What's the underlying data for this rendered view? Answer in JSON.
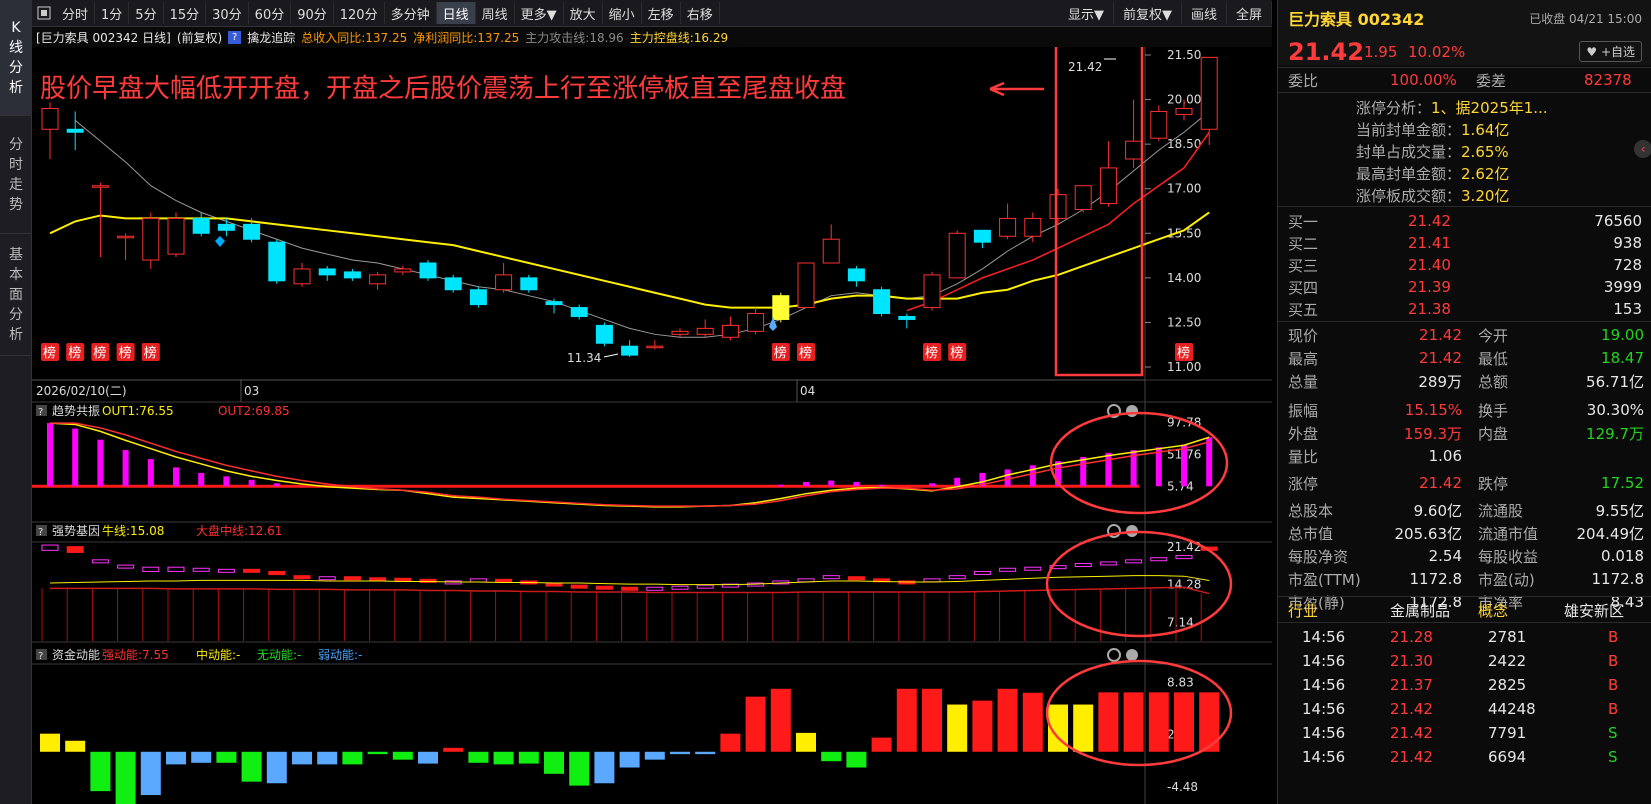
{
  "left_nav": {
    "tabs": [
      {
        "label": [
          "K",
          "线",
          "分",
          "析"
        ],
        "active": true
      },
      {
        "label": [
          "分",
          "时",
          "走",
          "势"
        ],
        "active": false
      },
      {
        "label": [
          "基",
          "本",
          "面",
          "分",
          "析"
        ],
        "active": false
      }
    ]
  },
  "toolbar": {
    "periods": [
      "分时",
      "1分",
      "5分",
      "15分",
      "30分",
      "60分",
      "90分",
      "120分",
      "多分钟",
      "日线",
      "周线",
      "更多▼"
    ],
    "active_period": "日线",
    "actions": [
      "放大",
      "缩小",
      "左移",
      "右移"
    ],
    "right_actions": [
      "显示▼",
      "前复权▼",
      "画线",
      "全屏"
    ]
  },
  "infobar": {
    "stock": "[巨力索具 002342 日线]",
    "adjust": "(前复权)",
    "q_icon": "?",
    "indicator": "擒龙追踪",
    "f1": "总收入同比:137.25",
    "f2": "净利润同比:137.25",
    "f3": "主力攻击线:18.96",
    "f4": "主力控盘线:16.29"
  },
  "main_chart": {
    "annotation": "股价早盘大幅低开开盘，开盘之后股价震荡上行至涨停板直至尾盘收盘",
    "y_ticks": [
      "21.50",
      "20.00",
      "18.50",
      "17.00",
      "15.50",
      "14.00",
      "12.50",
      "11.00"
    ],
    "high_label": "21.42",
    "low_label": "11.34",
    "date_labels": [
      "2026/02/10(二)",
      "03",
      "04"
    ],
    "bang_label": "榜",
    "colors": {
      "up": "#ff3030",
      "down": "#00e5ff",
      "ma_fast": "#ff2020",
      "ma_slow": "#ffee00",
      "ma_grey": "#9a9a9a",
      "annot": "#ff3b3b"
    }
  },
  "panel_trend": {
    "q": "?",
    "title": "趋势共振",
    "out1": "OUT1:76.55",
    "out2": "OUT2:69.85",
    "y_ticks": [
      "97.78",
      "51.76",
      "5.74"
    ]
  },
  "panel_strong": {
    "q": "?",
    "title": "强势基因",
    "l1": "牛线:15.08",
    "l2": "大盘中线:12.61",
    "y_ticks": [
      "21.42",
      "14.28",
      "7.14"
    ]
  },
  "panel_fund": {
    "q": "?",
    "title": "资金动能",
    "l1": "强动能:7.55",
    "l2": "中动能:-",
    "l3": "无动能:-",
    "l4": "弱动能:-",
    "y_ticks": [
      "8.83",
      "2.17",
      "-4.48"
    ]
  },
  "quote": {
    "name": "巨力索具 002342",
    "status": "已收盘 04/21 15:00",
    "price": "21.42",
    "change": "1.95",
    "pct": "10.02%",
    "watch": "+自选",
    "wb_label": "委比",
    "wb_value": "100.00%",
    "wc_label": "委差",
    "wc_value": "82378",
    "limit_lines": [
      "涨停分析：1、据2025年1...",
      "当前封单金额：1.64亿",
      "封单占成交量：2.65%",
      "最高封单金额：2.62亿",
      "涨停板成交额：3.20亿"
    ],
    "bids": [
      {
        "label": "买一",
        "price": "21.42",
        "vol": "76560"
      },
      {
        "label": "买二",
        "price": "21.41",
        "vol": "938"
      },
      {
        "label": "买三",
        "price": "21.40",
        "vol": "728"
      },
      {
        "label": "买四",
        "price": "21.39",
        "vol": "3999"
      },
      {
        "label": "买五",
        "price": "21.38",
        "vol": "153"
      }
    ],
    "stats": [
      {
        "l1": "现价",
        "v1": "21.42",
        "c1": "red",
        "l2": "今开",
        "v2": "19.00",
        "c2": "green"
      },
      {
        "l1": "最高",
        "v1": "21.42",
        "c1": "red",
        "l2": "最低",
        "v2": "18.47",
        "c2": "green"
      },
      {
        "l1": "总量",
        "v1": "289万",
        "c1": "white",
        "l2": "总额",
        "v2": "56.71亿",
        "c2": "white"
      },
      {
        "l1": "振幅",
        "v1": "15.15%",
        "c1": "red",
        "l2": "换手",
        "v2": "30.30%",
        "c2": "white"
      },
      {
        "l1": "外盘",
        "v1": "159.3万",
        "c1": "red",
        "l2": "内盘",
        "v2": "129.7万",
        "c2": "green"
      },
      {
        "l1": "量比",
        "v1": "1.06",
        "c1": "white",
        "l2": "",
        "v2": "",
        "c2": "white"
      },
      {
        "l1": "涨停",
        "v1": "21.42",
        "c1": "red",
        "l2": "跌停",
        "v2": "17.52",
        "c2": "green"
      },
      {
        "l1": "总股本",
        "v1": "9.60亿",
        "c1": "white",
        "l2": "流通股",
        "v2": "9.55亿",
        "c2": "white"
      },
      {
        "l1": "总市值",
        "v1": "205.63亿",
        "c1": "white",
        "l2": "流通市值",
        "v2": "204.49亿",
        "c2": "white"
      },
      {
        "l1": "每股净资",
        "v1": "2.54",
        "c1": "white",
        "l2": "每股收益",
        "v2": "0.018",
        "c2": "white"
      },
      {
        "l1": "市盈(TTM)",
        "v1": "1172.8",
        "c1": "white",
        "l2": "市盈(动)",
        "v2": "1172.8",
        "c2": "white"
      },
      {
        "l1": "市盈(静)",
        "v1": "1172.8",
        "c1": "white",
        "l2": "市净率",
        "v2": "8.43",
        "c2": "white"
      }
    ],
    "industry_label": "行业",
    "industry": "金属制品",
    "concept_label": "概念",
    "concept": "雄安新区",
    "ticks": [
      {
        "t": "14:56",
        "p": "21.28",
        "v": "2781",
        "s": "B"
      },
      {
        "t": "14:56",
        "p": "21.30",
        "v": "2422",
        "s": "B"
      },
      {
        "t": "14:56",
        "p": "21.37",
        "v": "2825",
        "s": "B"
      },
      {
        "t": "14:56",
        "p": "21.42",
        "v": "44248",
        "s": "B"
      },
      {
        "t": "14:56",
        "p": "21.42",
        "v": "7791",
        "s": "S"
      },
      {
        "t": "14:56",
        "p": "21.42",
        "v": "6694",
        "s": "S"
      }
    ]
  },
  "chart_data": {
    "type": "candlestick",
    "y_range": [
      11.0,
      21.5
    ],
    "candles": [
      [
        19.0,
        19.7,
        19.9,
        18.0
      ],
      [
        19.0,
        18.9,
        19.6,
        18.3
      ],
      [
        17.1,
        17.1,
        17.2,
        14.7
      ],
      [
        15.4,
        15.4,
        15.5,
        14.6
      ],
      [
        14.6,
        16.0,
        16.2,
        14.3
      ],
      [
        14.8,
        16.0,
        16.2,
        14.7
      ],
      [
        16.0,
        15.5,
        16.2,
        15.4
      ],
      [
        15.8,
        15.6,
        16.0,
        15.4
      ],
      [
        15.8,
        15.3,
        16.0,
        15.2
      ],
      [
        15.2,
        13.9,
        15.3,
        13.8
      ],
      [
        13.8,
        14.3,
        14.5,
        13.7
      ],
      [
        14.3,
        14.1,
        14.4,
        13.9
      ],
      [
        14.2,
        14.0,
        14.3,
        13.9
      ],
      [
        13.8,
        14.1,
        14.2,
        13.6
      ],
      [
        14.2,
        14.3,
        14.4,
        14.1
      ],
      [
        14.5,
        14.0,
        14.6,
        13.9
      ],
      [
        14.0,
        13.6,
        14.1,
        13.5
      ],
      [
        13.6,
        13.1,
        13.7,
        13.0
      ],
      [
        13.6,
        14.1,
        14.5,
        13.5
      ],
      [
        14.0,
        13.6,
        14.1,
        13.5
      ],
      [
        13.2,
        13.1,
        13.3,
        12.8
      ],
      [
        13.0,
        12.7,
        13.1,
        12.6
      ],
      [
        12.4,
        11.8,
        12.5,
        11.7
      ],
      [
        11.7,
        11.4,
        11.9,
        11.34
      ],
      [
        11.7,
        11.7,
        11.9,
        11.6
      ],
      [
        12.1,
        12.2,
        12.3,
        12.0
      ],
      [
        12.1,
        12.3,
        12.6,
        12.0
      ],
      [
        12.0,
        12.4,
        12.7,
        11.9
      ],
      [
        12.2,
        12.8,
        13.0,
        12.1
      ],
      [
        12.6,
        13.4,
        13.5,
        12.5
      ],
      [
        13.0,
        14.5,
        14.5,
        13.0
      ],
      [
        14.5,
        15.3,
        15.8,
        14.5
      ],
      [
        14.3,
        13.9,
        14.4,
        13.7
      ],
      [
        13.6,
        12.8,
        13.7,
        12.7
      ],
      [
        12.7,
        12.6,
        12.8,
        12.3
      ],
      [
        13.0,
        14.1,
        14.2,
        12.9
      ],
      [
        14.0,
        15.5,
        15.6,
        14.0
      ],
      [
        15.6,
        15.2,
        15.6,
        15.0
      ],
      [
        15.4,
        16.0,
        16.5,
        15.3
      ],
      [
        15.4,
        16.0,
        16.2,
        15.2
      ],
      [
        16.0,
        16.8,
        17.0,
        15.8
      ],
      [
        16.3,
        17.1,
        17.1,
        16.2
      ],
      [
        16.5,
        17.7,
        18.6,
        16.4
      ],
      [
        18.0,
        18.6,
        20.0,
        17.7
      ],
      [
        18.7,
        19.6,
        19.8,
        18.6
      ],
      [
        19.5,
        19.7,
        20.0,
        19.3
      ],
      [
        19.0,
        21.42,
        21.42,
        18.47
      ]
    ],
    "ma_slow": [
      15.5,
      15.9,
      16.1,
      16.0,
      16.0,
      16.0,
      16.0,
      16.0,
      15.9,
      15.8,
      15.7,
      15.6,
      15.5,
      15.4,
      15.3,
      15.2,
      15.1,
      14.9,
      14.7,
      14.5,
      14.3,
      14.1,
      13.9,
      13.7,
      13.5,
      13.3,
      13.1,
      13.0,
      13.0,
      13.0,
      13.1,
      13.3,
      13.4,
      13.4,
      13.3,
      13.3,
      13.3,
      13.5,
      13.6,
      13.9,
      14.1,
      14.4,
      14.7,
      15.0,
      15.3,
      15.6,
      16.2
    ],
    "ma_grey": [
      null,
      19.3,
      18.6,
      17.9,
      17.1,
      16.6,
      16.2,
      15.9,
      15.6,
      15.3,
      15.0,
      14.8,
      14.6,
      14.5,
      14.3,
      14.1,
      13.9,
      13.7,
      13.6,
      13.4,
      13.2,
      12.9,
      12.6,
      12.3,
      12.1,
      12.0,
      12.0,
      12.1,
      12.3,
      12.6,
      13.0,
      13.4,
      13.5,
      13.4,
      13.3,
      13.4,
      13.8,
      14.3,
      14.9,
      15.4,
      15.8,
      16.3,
      16.9,
      17.6,
      18.3,
      18.9,
      19.6
    ],
    "ma_red": [
      null,
      null,
      null,
      null,
      null,
      null,
      null,
      null,
      null,
      null,
      null,
      null,
      null,
      null,
      null,
      null,
      null,
      null,
      null,
      null,
      null,
      null,
      null,
      null,
      null,
      null,
      null,
      null,
      null,
      null,
      null,
      null,
      null,
      null,
      12.9,
      13.2,
      13.6,
      14.0,
      14.3,
      14.6,
      15.0,
      15.4,
      15.8,
      16.5,
      17.1,
      17.7,
      18.9
    ],
    "bang_index": [
      0,
      1,
      2,
      3,
      4,
      29,
      30,
      35,
      36,
      45
    ],
    "highlight": [
      29
    ],
    "trend_bars": [
      97,
      89,
      73,
      58,
      45,
      33,
      25,
      20,
      15,
      10,
      6,
      3,
      1,
      0,
      0,
      0,
      0,
      0,
      0,
      0,
      0,
      0,
      0,
      0,
      0,
      0,
      0,
      0,
      2,
      8,
      12,
      14,
      12,
      8,
      5,
      10,
      18,
      25,
      30,
      36,
      42,
      48,
      54,
      58,
      62,
      66,
      76.55
    ],
    "trend_out1": [
      97,
      95,
      85,
      72,
      60,
      48,
      38,
      28,
      20,
      14,
      9,
      5,
      3,
      1,
      0,
      -5,
      -10,
      -12,
      -14,
      -16,
      -18,
      -20,
      -22,
      -23,
      -24,
      -24,
      -23,
      -22,
      -18,
      -12,
      -5,
      0,
      3,
      4,
      2,
      -1,
      5,
      12,
      22,
      30,
      38,
      44,
      50,
      55,
      60,
      65,
      76.55
    ],
    "trend_out2": [
      97,
      97,
      90,
      80,
      68,
      56,
      46,
      36,
      28,
      20,
      14,
      9,
      5,
      2,
      0,
      -3,
      -8,
      -10,
      -13,
      -15,
      -17,
      -19,
      -21,
      -22,
      -23,
      -23,
      -23,
      -22,
      -20,
      -15,
      -8,
      -2,
      1,
      3,
      3,
      0,
      2,
      8,
      16,
      24,
      32,
      38,
      44,
      50,
      55,
      60,
      69.85
    ],
    "strong_open": [
      20.8,
      21.5,
      19,
      18,
      16.8,
      16.8,
      17.0,
      17.0,
      17.2,
      16.8,
      16.0,
      15.4,
      15.8,
      15.6,
      15.5,
      15.3,
      15.0,
      14.8,
      15.3,
      15.0,
      14.6,
      14.2,
      14.0,
      13.8,
      13.8,
      14.0,
      14.2,
      14.4,
      14.6,
      15.0,
      15.4,
      16.0,
      15.8,
      15.4,
      15.0,
      15.2,
      15.8,
      16.6,
      17.0,
      17.2,
      17.6,
      18.0,
      18.4,
      18.8,
      19.2,
      19.4,
      21.42
    ],
    "strong_close": [
      21.8,
      20.4,
      19,
      18,
      17.6,
      17.6,
      17.4,
      17.2,
      16.8,
      16.2,
      15.9,
      15.8,
      15.6,
      15.5,
      15.4,
      15.2,
      15.0,
      15.4,
      15.0,
      14.6,
      14.2,
      14.0,
      13.8,
      13.6,
      13.8,
      14.0,
      14.2,
      14.4,
      14.6,
      15.0,
      15.4,
      16.0,
      15.6,
      15.0,
      14.8,
      15.4,
      16.0,
      16.8,
      17.4,
      17.6,
      17.9,
      18.3,
      18.6,
      19.0,
      19.4,
      19.8,
      20.8
    ],
    "strong_yline": [
      14.6,
      14.7,
      14.8,
      14.9,
      15.0,
      15.0,
      15.1,
      15.1,
      15.1,
      15.1,
      15.1,
      15.0,
      15.0,
      15.0,
      14.9,
      14.9,
      14.8,
      14.8,
      14.7,
      14.7,
      14.6,
      14.6,
      14.5,
      14.4,
      14.4,
      14.3,
      14.3,
      14.3,
      14.4,
      14.6,
      14.8,
      15.0,
      15.0,
      14.9,
      14.8,
      14.8,
      14.9,
      15.1,
      15.3,
      15.5,
      15.7,
      15.8,
      15.9,
      16.0,
      16.0,
      15.9,
      15.08
    ],
    "strong_redline": [
      13.6,
      13.6,
      13.6,
      13.6,
      13.6,
      13.5,
      13.5,
      13.5,
      13.5,
      13.4,
      13.4,
      13.4,
      13.3,
      13.3,
      13.3,
      13.2,
      13.2,
      13.1,
      13.1,
      13.0,
      13.0,
      12.9,
      12.9,
      12.9,
      12.8,
      12.8,
      12.8,
      12.8,
      12.8,
      12.8,
      12.9,
      12.9,
      12.9,
      12.9,
      12.9,
      12.9,
      12.9,
      13.0,
      13.1,
      13.2,
      13.3,
      13.4,
      13.5,
      13.6,
      13.7,
      13.8,
      12.61
    ],
    "fund_values": [
      2.3,
      1.4,
      -5.0,
      -7.0,
      -5.5,
      -1.6,
      -1.4,
      -1.4,
      -3.8,
      -4.0,
      -1.6,
      -1.6,
      -1.6,
      -0.3,
      -1.0,
      -1.5,
      0.5,
      -1.4,
      -1.6,
      -1.5,
      -2.8,
      -4.3,
      -4.0,
      -2.0,
      -1.0,
      -0.3,
      -0.3,
      2.3,
      7.0,
      8.0,
      2.4,
      -1.2,
      -2.0,
      1.8,
      8.0,
      8.0,
      6.0,
      6.5,
      8.0,
      7.5,
      6.0,
      6.0,
      7.55,
      7.55,
      7.55,
      7.55,
      7.55
    ],
    "fund_colors": [
      "y",
      "y",
      "g",
      "g",
      "b",
      "b",
      "b",
      "g",
      "g",
      "b",
      "b",
      "b",
      "g",
      "g",
      "g",
      "b",
      "r",
      "g",
      "g",
      "g",
      "g",
      "g",
      "b",
      "b",
      "b",
      "b",
      "b",
      "r",
      "r",
      "r",
      "y",
      "g",
      "g",
      "r",
      "r",
      "r",
      "y",
      "r",
      "r",
      "r",
      "y",
      "y",
      "r",
      "r",
      "r",
      "r",
      "r"
    ],
    "circles": 3
  }
}
